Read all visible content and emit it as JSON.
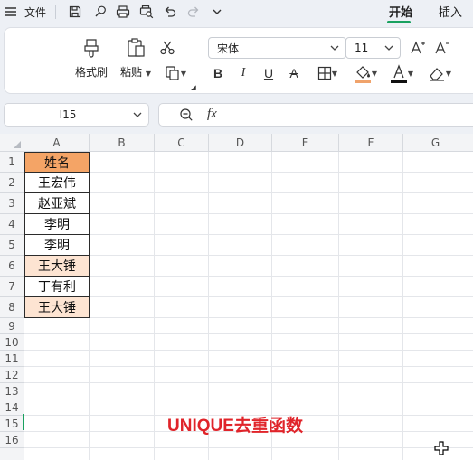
{
  "titlebar": {
    "menu_icon": "hamburger-menu-icon",
    "file_label": "文件",
    "quick_access": [
      "save-icon",
      "brush-icon",
      "print-icon",
      "print-preview-icon",
      "undo-icon",
      "redo-icon",
      "chevron-down-icon"
    ],
    "tabs": [
      {
        "label": "开始",
        "active": true
      },
      {
        "label": "插入",
        "active": false
      }
    ],
    "accent_color": "#19a15f"
  },
  "ribbon": {
    "format_painter_label": "格式刷",
    "paste_label": "粘贴",
    "cut_icon": "scissors-icon",
    "copy_icon": "copy-icon",
    "font_name": "宋体",
    "font_size": "11",
    "grow_font_icon": "increase-font-icon",
    "shrink_font_icon": "decrease-font-icon",
    "format_buttons": [
      {
        "label": "B",
        "name": "bold-button"
      },
      {
        "label": "I",
        "name": "italic-button"
      },
      {
        "label": "U",
        "name": "underline-button"
      },
      {
        "label": "A",
        "name": "strikethrough-button"
      }
    ],
    "border_icon": "borders-icon",
    "fill_color": "#f0a36b",
    "font_color": "#111111",
    "eraser_icon": "clear-format-icon"
  },
  "formula_bar": {
    "name_box": "I15",
    "zoom_icon": "zoom-icon",
    "fx_label": "fx",
    "formula": ""
  },
  "sheet": {
    "columns": [
      "A",
      "B",
      "C",
      "D",
      "E",
      "F",
      "G"
    ],
    "rows": [
      "1",
      "2",
      "3",
      "4",
      "5",
      "6",
      "7",
      "8",
      "9",
      "10",
      "11",
      "12",
      "13",
      "14",
      "15",
      "16"
    ],
    "column_a_cells": [
      {
        "value": "姓名",
        "fill": "#f4a466"
      },
      {
        "value": "王宏伟",
        "fill": "#ffffff"
      },
      {
        "value": "赵亚斌",
        "fill": "#ffffff"
      },
      {
        "value": "李明",
        "fill": "#ffffff"
      },
      {
        "value": "李明",
        "fill": "#ffffff"
      },
      {
        "value": "王大锤",
        "fill": "#fde4d2"
      },
      {
        "value": "丁有利",
        "fill": "#ffffff"
      },
      {
        "value": "王大锤",
        "fill": "#fde4d2"
      }
    ],
    "caption": "UNIQUE去重函数",
    "caption_color": "#e0242a"
  },
  "cursor_icon": "crosshair-cursor-icon"
}
